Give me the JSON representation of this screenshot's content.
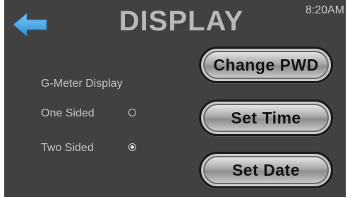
{
  "header": {
    "title": "DISPLAY",
    "time": "8:20AM",
    "back_icon": "left-arrow-icon",
    "accent_color": "#4aa8e8"
  },
  "g_meter": {
    "section_label": "G-Meter Display",
    "options": [
      {
        "label": "One Sided",
        "selected": false
      },
      {
        "label": "Two Sided",
        "selected": true
      }
    ]
  },
  "buttons": {
    "change_pwd": "Change PWD",
    "set_time": "Set Time",
    "set_date": "Set Date"
  }
}
